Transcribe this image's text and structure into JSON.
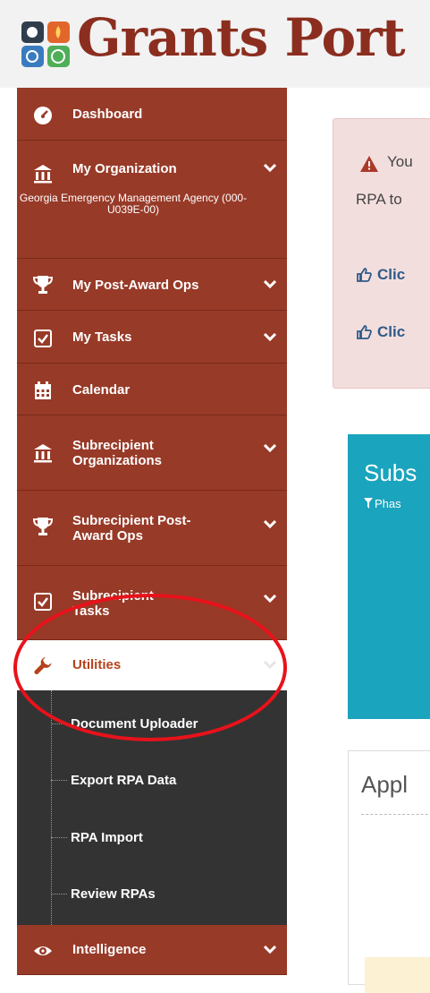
{
  "header": {
    "logo_text": "Grants Port"
  },
  "sidebar": {
    "items": [
      {
        "label": "Dashboard",
        "icon": "dashboard-gauge-icon"
      },
      {
        "label": "My Organization",
        "icon": "institution-icon",
        "sub": "Georgia Emergency Management Agency (000-U039E-00)"
      },
      {
        "label": "My Post-Award Ops",
        "icon": "trophy-icon"
      },
      {
        "label": "My Tasks",
        "icon": "checkbox-icon"
      },
      {
        "label": "Calendar",
        "icon": "calendar-icon"
      },
      {
        "label": "Subrecipient Organizations",
        "icon": "institution-icon"
      },
      {
        "label": "Subrecipient Post-Award Ops",
        "icon": "trophy-icon"
      },
      {
        "label": "Subrecipient Tasks",
        "icon": "checkbox-icon"
      },
      {
        "label": "Utilities",
        "icon": "wrench-icon"
      },
      {
        "label": "Intelligence",
        "icon": "eye-icon"
      }
    ],
    "utilities_submenu": [
      {
        "label": "Document Uploader"
      },
      {
        "label": "Export RPA Data"
      },
      {
        "label": "RPA Import"
      },
      {
        "label": "Review RPAs"
      }
    ]
  },
  "main": {
    "alert": {
      "line1": "You",
      "line2": "RPA to",
      "link1": "Clic",
      "link2": "Clic"
    },
    "panel_blue": {
      "title": "Subs",
      "filter": "Phas"
    },
    "panel_white": {
      "title": "Appl"
    }
  },
  "colors": {
    "sidebar": "#983a28",
    "submenu": "#333333",
    "accent": "#b5421b",
    "header_text": "#8b2e1f",
    "annotation": "#e8121b"
  }
}
